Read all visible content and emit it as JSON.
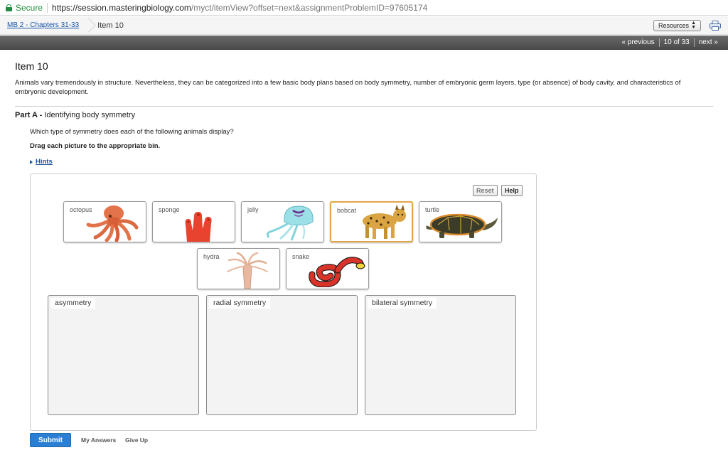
{
  "browser": {
    "secure_label": "Secure",
    "url_host": "https://session.masteringbiology.com",
    "url_path": "/myct/itemView?offset=next&assignmentProblemID=97605174"
  },
  "breadcrumb": {
    "course_link": "MB 2 - Chapters 31-33",
    "current": "Item 10",
    "resources_label": "Resources"
  },
  "pager": {
    "previous": "« previous",
    "position": "10 of 33",
    "next": "next »"
  },
  "item": {
    "title": "Item 10",
    "intro": "Animals vary tremendously in structure. Nevertheless, they can be categorized into a few basic body plans based on body symmetry, number of embryonic germ layers, type (or absence) of body cavity, and characteristics of embryonic development.",
    "part_prefix": "Part A - ",
    "part_title": "Identifying body symmetry",
    "question": "Which type of symmetry does each of the following animals display?",
    "instruction": "Drag each picture to the appropriate bin.",
    "hints_label": "Hints"
  },
  "activity": {
    "reset_label": "Reset",
    "help_label": "Help",
    "cards": [
      {
        "label": "octopus",
        "icon": "octopus-image",
        "color": "#e2734a"
      },
      {
        "label": "sponge",
        "icon": "sponge-image",
        "color": "#e8432e"
      },
      {
        "label": "jelly",
        "icon": "jellyfish-image",
        "color": "#7fd3dc"
      },
      {
        "label": "bobcat",
        "icon": "bobcat-image",
        "color": "#d9a441"
      },
      {
        "label": "turtle",
        "icon": "turtle-image",
        "color": "#3b3b2a"
      },
      {
        "label": "hydra",
        "icon": "hydra-image",
        "color": "#e8b9a0"
      },
      {
        "label": "snake",
        "icon": "snake-image",
        "color": "#d8342a"
      }
    ],
    "bins": [
      {
        "label": "asymmetry"
      },
      {
        "label": "radial symmetry"
      },
      {
        "label": "bilateral symmetry"
      }
    ]
  },
  "footer": {
    "submit_label": "Submit",
    "my_answers_label": "My Answers",
    "give_up_label": "Give Up"
  }
}
